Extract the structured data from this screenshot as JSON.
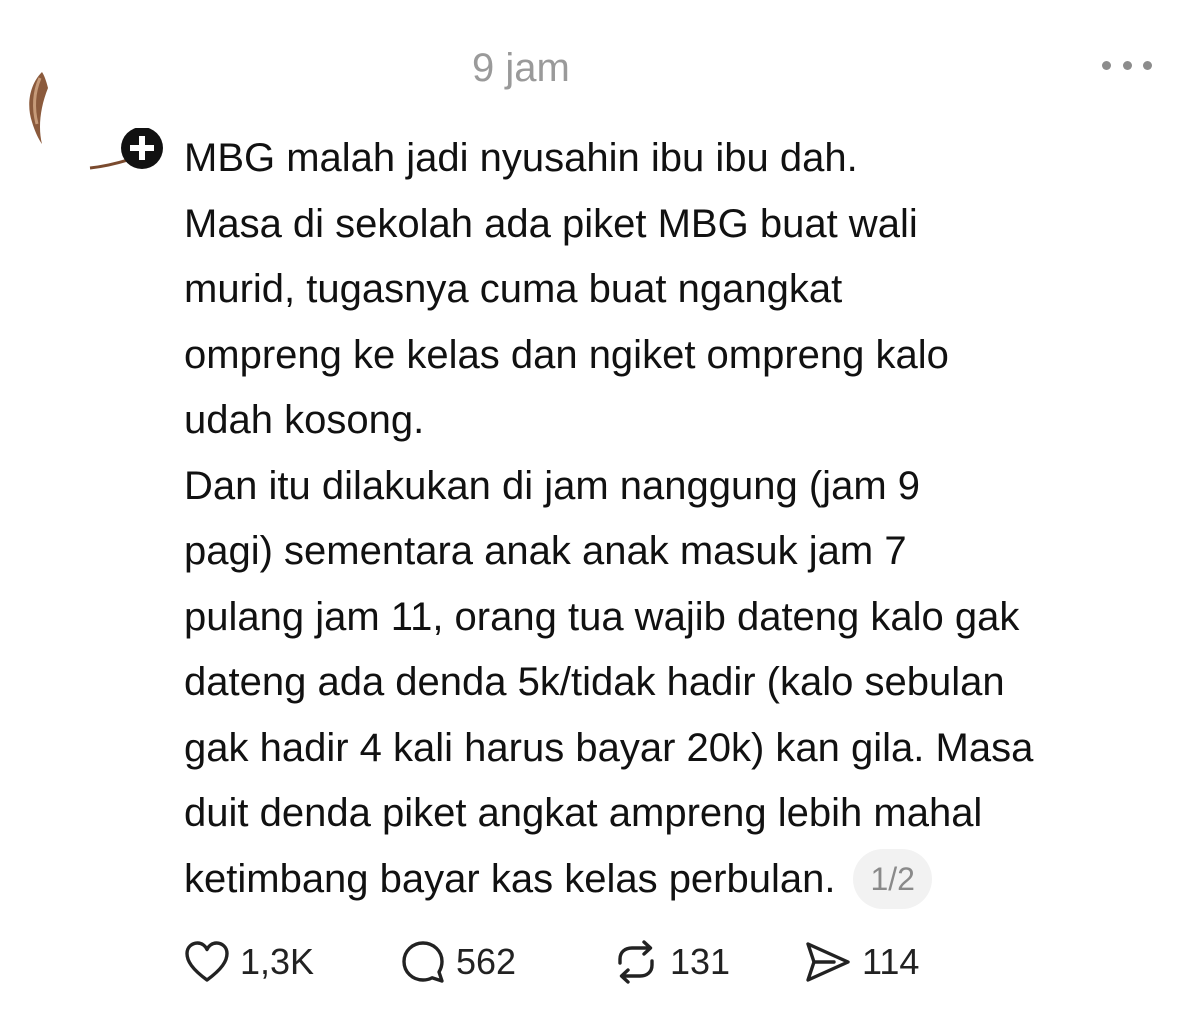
{
  "post": {
    "timestamp": "9 jam",
    "text_lines": [
      "MBG malah jadi nyusahin ibu ibu dah.",
      "Masa di sekolah ada piket MBG buat wali",
      "murid,  tugasnya cuma buat ngangkat",
      "ompreng ke kelas dan ngiket ompreng kalo",
      "udah kosong.",
      "Dan itu dilakukan di jam nanggung (jam 9",
      "pagi) sementara anak anak masuk jam 7",
      "pulang jam 11, orang tua wajib dateng kalo gak",
      "dateng ada denda 5k/tidak hadir (kalo sebulan",
      "gak hadir 4 kali harus bayar 20k) kan gila. Masa",
      "duit denda piket angkat ampreng lebih mahal",
      "ketimbang bayar kas kelas perbulan."
    ],
    "page_indicator": "1/2"
  },
  "actions": {
    "like_count": "1,3K",
    "reply_count": "562",
    "repost_count": "131",
    "share_count": "114"
  },
  "icons": {
    "more": "more-horizontal-icon",
    "like": "heart-icon",
    "reply": "comment-bubble-icon",
    "repost": "repost-icon",
    "share": "send-icon"
  },
  "colors": {
    "text": "#111111",
    "muted": "#9a9a9a",
    "badge_bg": "#f2f2f2"
  }
}
